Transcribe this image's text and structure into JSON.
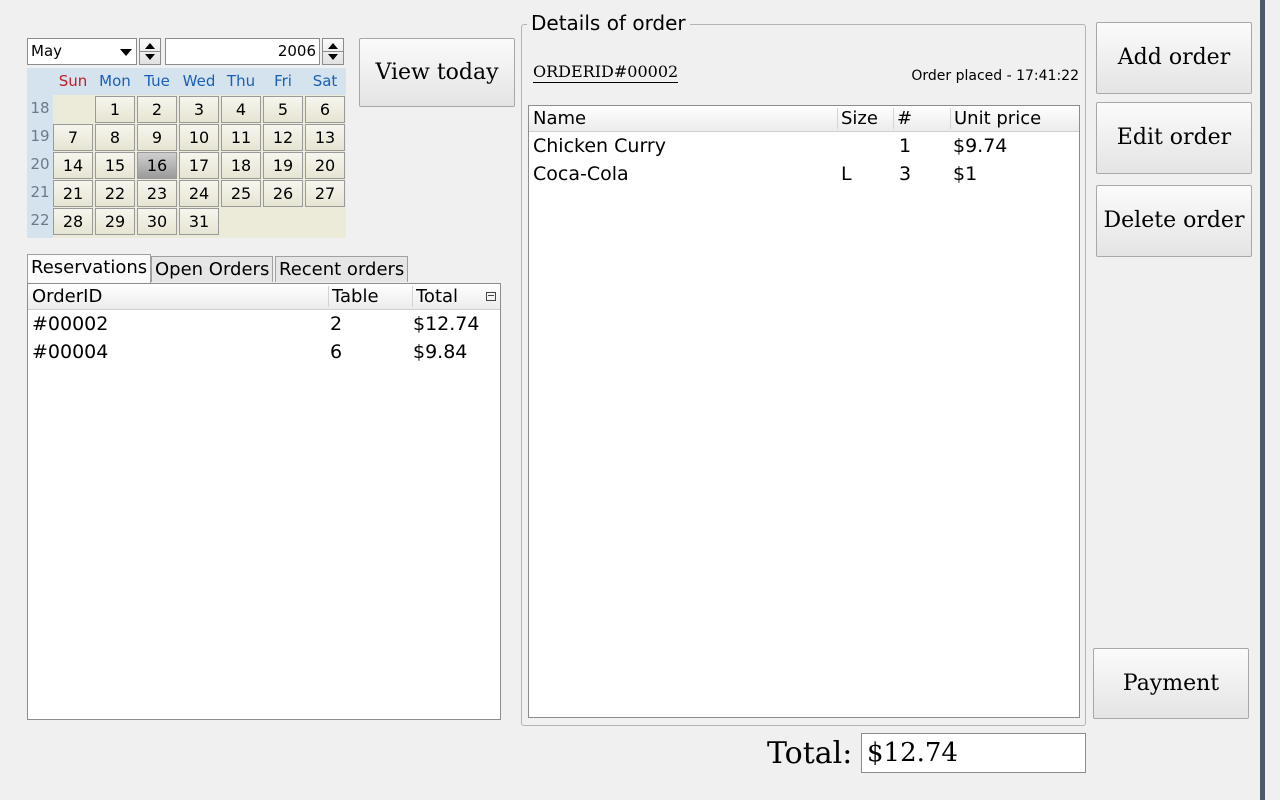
{
  "calendar": {
    "month": "May",
    "year": "2006",
    "weekdays": [
      "Sun",
      "Mon",
      "Tue",
      "Wed",
      "Thu",
      "Fri",
      "Sat"
    ],
    "week_numbers": [
      "18",
      "19",
      "20",
      "21",
      "22"
    ],
    "selected_day": "16",
    "rows": [
      [
        "",
        "1",
        "2",
        "3",
        "4",
        "5",
        "6"
      ],
      [
        "7",
        "8",
        "9",
        "10",
        "11",
        "12",
        "13"
      ],
      [
        "14",
        "15",
        "16",
        "17",
        "18",
        "19",
        "20"
      ],
      [
        "21",
        "22",
        "23",
        "24",
        "25",
        "26",
        "27"
      ],
      [
        "28",
        "29",
        "30",
        "31",
        "",
        "",
        ""
      ]
    ],
    "colors": {
      "header_bg": "#d4e3ee",
      "sunday": "#c01c28",
      "weekday": "#1a5fb4"
    }
  },
  "buttons": {
    "view_today": "View today",
    "add_order": "Add order",
    "edit_order": "Edit order",
    "delete_order": "Delete order",
    "payment": "Payment"
  },
  "tabs": [
    {
      "label": "Reservations",
      "active": true
    },
    {
      "label": "Open Orders",
      "active": false
    },
    {
      "label": "Recent orders",
      "active": false
    }
  ],
  "orders_list": {
    "columns": [
      "OrderID",
      "Table",
      "Total"
    ],
    "column_menu_icon": "column-chooser-icon",
    "rows": [
      {
        "order_id": "#00002",
        "table": "2",
        "total": "$12.74"
      },
      {
        "order_id": "#00004",
        "table": "6",
        "total": "$9.84"
      }
    ]
  },
  "details": {
    "group_title": "Details of order",
    "order_id": "ORDERID#00002",
    "placed": "Order placed - 17:41:22",
    "columns": [
      "Name",
      "Size",
      "#",
      "Unit price"
    ],
    "items": [
      {
        "name": "Chicken Curry",
        "size": "",
        "qty": "1",
        "unit_price": "$9.74"
      },
      {
        "name": "Coca-Cola",
        "size": "L",
        "qty": "3",
        "unit_price": "$1"
      }
    ]
  },
  "total": {
    "label": "Total:",
    "value": "$12.74"
  }
}
